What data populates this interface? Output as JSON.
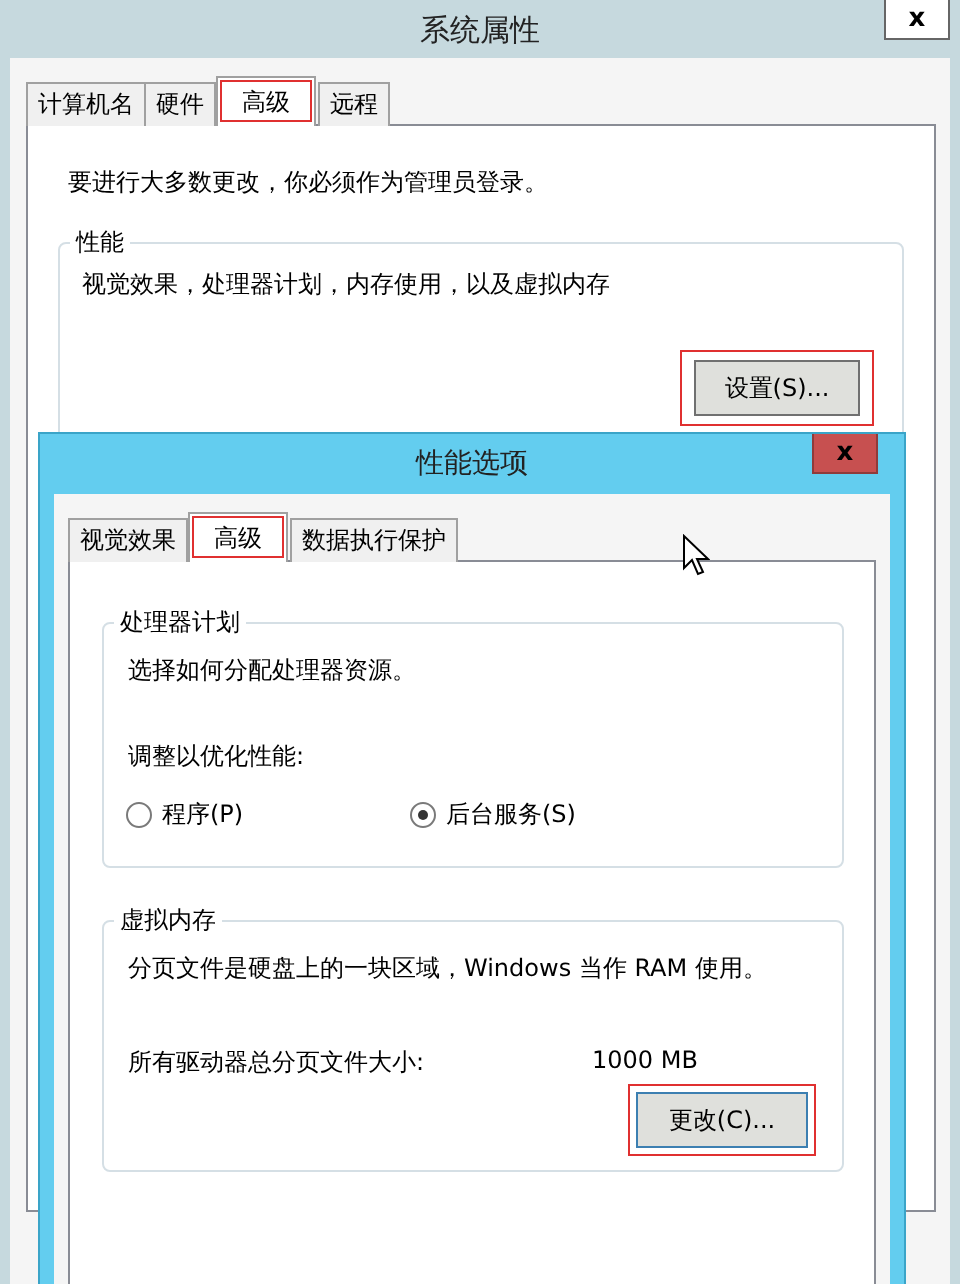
{
  "window": {
    "title": "系统属性",
    "close": "x"
  },
  "tabs": [
    {
      "label": "计算机名",
      "selected": false,
      "highlighted": false
    },
    {
      "label": "硬件",
      "selected": false,
      "highlighted": false
    },
    {
      "label": "高级",
      "selected": true,
      "highlighted": true
    },
    {
      "label": "远程",
      "selected": false,
      "highlighted": false
    }
  ],
  "notice": "要进行大多数更改，你必须作为管理员登录。",
  "performance": {
    "legend": "性能",
    "description": "视觉效果，处理器计划，内存使用，以及虚拟内存",
    "button": {
      "label": "设置(S)...",
      "highlighted": true
    }
  },
  "dialog": {
    "title": "性能选项",
    "close": "x",
    "tabs": [
      {
        "label": "视觉效果",
        "selected": false,
        "highlighted": false
      },
      {
        "label": "高级",
        "selected": true,
        "highlighted": true
      },
      {
        "label": "数据执行保护",
        "selected": false,
        "highlighted": false
      }
    ],
    "processor": {
      "legend": "处理器计划",
      "description": "选择如何分配处理器资源。",
      "prompt": "调整以优化性能:",
      "options": [
        {
          "label": "程序(P)",
          "selected": false
        },
        {
          "label": "后台服务(S)",
          "selected": true
        }
      ]
    },
    "virtual_memory": {
      "legend": "虚拟内存",
      "description": "分页文件是硬盘上的一块区域，Windows 当作 RAM 使用。",
      "total_label": "所有驱动器总分页文件大小:",
      "total_value": "1000 MB",
      "button": {
        "label": "更改(C)...",
        "highlighted": true
      }
    }
  }
}
